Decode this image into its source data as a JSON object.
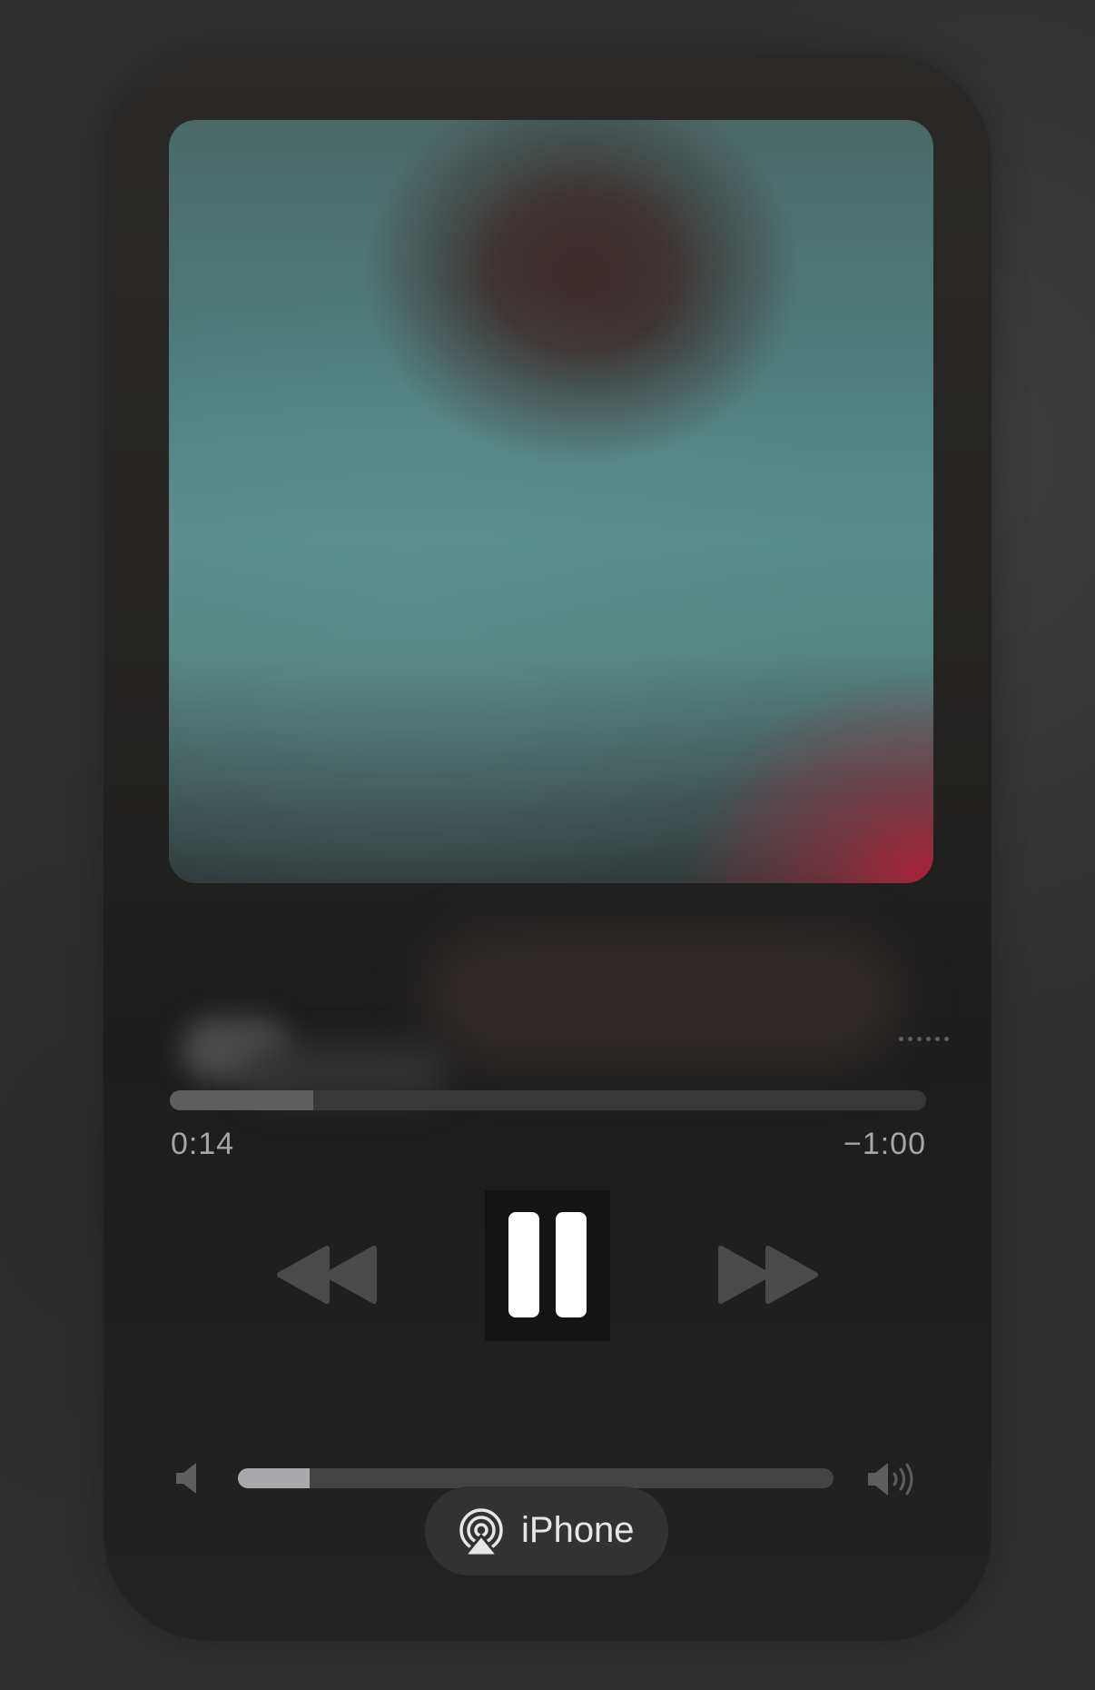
{
  "player": {
    "elapsed": "0:14",
    "remaining": "−1:00",
    "progress_fraction": 0.19,
    "volume_fraction": 0.12,
    "is_playing": true
  },
  "controls": {
    "rewind_icon": "backward-icon",
    "pause_icon": "pause-icon",
    "forward_icon": "forward-icon",
    "more_icon": "ellipsis-icon",
    "volume_low_icon": "speaker-low-icon",
    "volume_high_icon": "speaker-high-icon"
  },
  "output": {
    "device_label": "iPhone",
    "icon": "airplay-icon"
  },
  "colors": {
    "pause_glyph": "#ffffff",
    "transport_glyph": "#4a4a4a",
    "volume_fill": "#a9a9ab"
  }
}
